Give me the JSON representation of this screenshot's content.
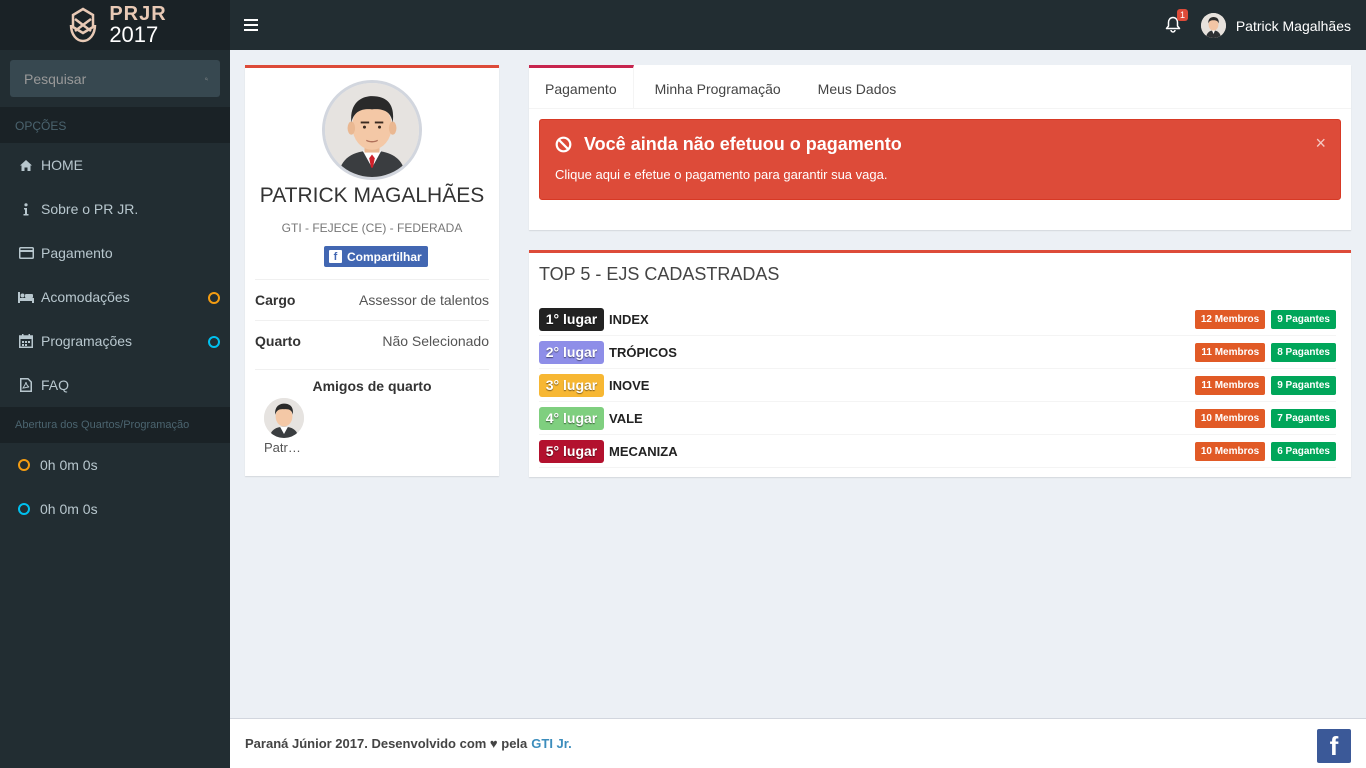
{
  "brand": {
    "line1": "PRJR",
    "line2": "2017"
  },
  "sidebar": {
    "search_placeholder": "Pesquisar",
    "section_options": "OPÇÕES",
    "items": [
      {
        "label": "HOME",
        "icon": "home-icon"
      },
      {
        "label": "Sobre o PR JR.",
        "icon": "info-icon"
      },
      {
        "label": "Pagamento",
        "icon": "credit-card-icon"
      },
      {
        "label": "Acomodações",
        "icon": "bed-icon",
        "indicator_color": "#f39c12"
      },
      {
        "label": "Programações",
        "icon": "calendar-icon",
        "indicator_color": "#00c0ef"
      },
      {
        "label": "FAQ",
        "icon": "pdf-file-icon"
      }
    ],
    "section_opening": "Abertura dos Quartos/Programação",
    "timers": [
      {
        "value": "0h 0m 0s",
        "color": "#f39c12"
      },
      {
        "value": "0h 0m 0s",
        "color": "#00c0ef"
      }
    ]
  },
  "topbar": {
    "notifications_count": "1",
    "user_name": "Patrick Magalhães"
  },
  "profile": {
    "name": "PATRICK MAGALHÃES",
    "subtitle": "GTI - FEJECE (CE) - FEDERADA",
    "share_label": "Compartilhar",
    "rows": [
      {
        "key": "Cargo",
        "value": "Assessor de talentos"
      },
      {
        "key": "Quarto",
        "value": "Não Selecionado"
      }
    ],
    "friends_title": "Amigos de quarto",
    "friends": [
      {
        "name": "Patr…"
      }
    ]
  },
  "tabs": [
    {
      "label": "Pagamento",
      "active": true
    },
    {
      "label": "Minha Programação",
      "active": false
    },
    {
      "label": "Meus Dados",
      "active": false
    }
  ],
  "alert": {
    "title": "Você ainda não efetuou o pagamento",
    "message": "Clique aqui e efetue o pagamento para garantir sua vaga.",
    "close": "×"
  },
  "top5": {
    "title": "TOP 5 - EJS CADASTRADAS",
    "rows": [
      {
        "place": "1° lugar",
        "name": "INDEX",
        "members": "12 Membros",
        "payers": "9 Pagantes",
        "color": "#222222"
      },
      {
        "place": "2° lugar",
        "name": "TRÓPICOS",
        "members": "11 Membros",
        "payers": "8 Pagantes",
        "color": "#8e8ee8"
      },
      {
        "place": "3° lugar",
        "name": "INOVE",
        "members": "11 Membros",
        "payers": "9 Pagantes",
        "color": "#f7b733"
      },
      {
        "place": "4° lugar",
        "name": "VALE",
        "members": "10 Membros",
        "payers": "7 Pagantes",
        "color": "#7fcf7f"
      },
      {
        "place": "5° lugar",
        "name": "MECANIZA",
        "members": "10 Membros",
        "payers": "6 Pagantes",
        "color": "#b3112e"
      }
    ]
  },
  "footer": {
    "text": "Paraná Júnior 2017. Desenvolvido com ♥ pela",
    "link": "GTI Jr."
  }
}
